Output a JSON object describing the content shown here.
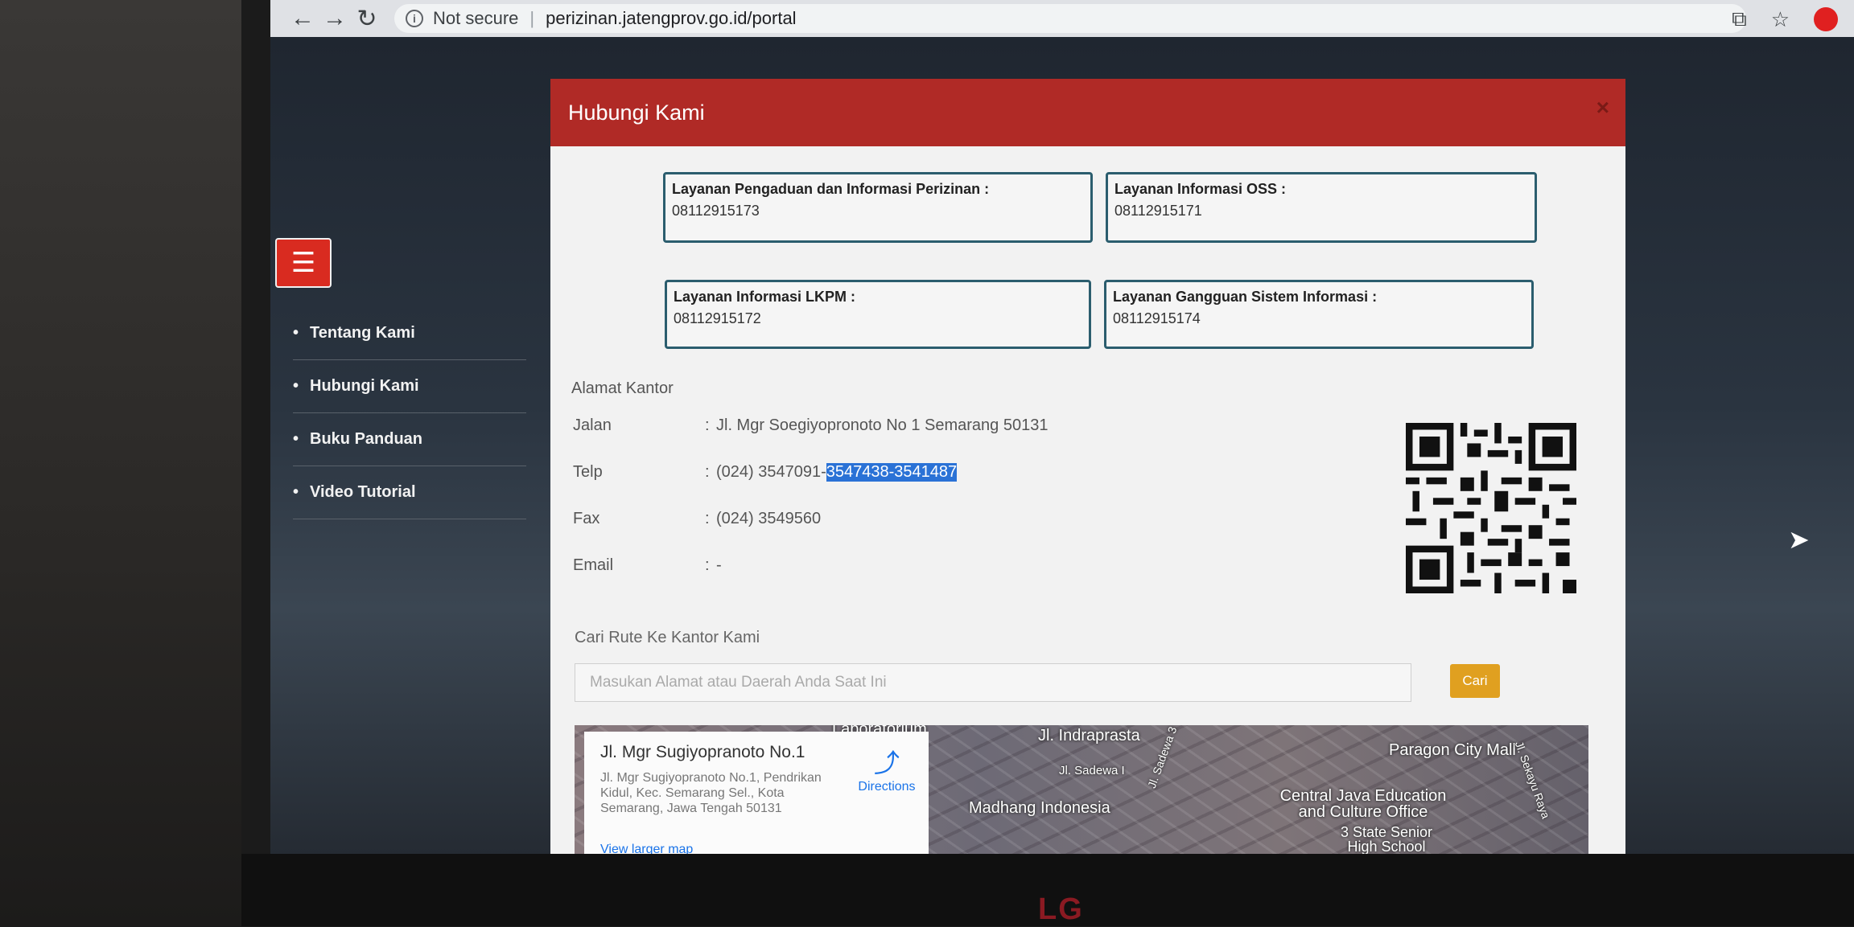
{
  "browser": {
    "security_label": "Not secure",
    "url": "perizinan.jatengprov.go.id/portal"
  },
  "sidebar": {
    "items": [
      {
        "label": "Tentang Kami"
      },
      {
        "label": "Hubungi Kami"
      },
      {
        "label": "Buku Panduan"
      },
      {
        "label": "Video Tutorial"
      }
    ]
  },
  "modal": {
    "title": "Hubungi Kami",
    "close": "×",
    "cards": [
      {
        "title": "Layanan Pengaduan dan Informasi Perizinan :",
        "phone": "08112915173"
      },
      {
        "title": "Layanan Informasi OSS :",
        "phone": "08112915171"
      },
      {
        "title": "Layanan Informasi LKPM :",
        "phone": "08112915172"
      },
      {
        "title": "Layanan Gangguan Sistem Informasi :",
        "phone": "08112915174"
      }
    ],
    "address_heading": "Alamat Kantor",
    "address": {
      "jalan_label": "Jalan",
      "jalan_value": "Jl. Mgr Soegiyopronoto No 1 Semarang 50131",
      "telp_label": "Telp",
      "telp_value_plain": "(024) 3547091-",
      "telp_value_selected": "3547438-3541487",
      "fax_label": "Fax",
      "fax_value": "(024) 3549560",
      "email_label": "Email",
      "email_value": "-",
      "colon": ":"
    },
    "route": {
      "label": "Cari Rute Ke Kantor Kami",
      "placeholder": "Masukan Alamat atau Daerah Anda Saat Ini",
      "button": "Cari"
    },
    "map": {
      "place_title": "Jl. Mgr Sugiyopranoto No.1",
      "place_address": "Jl. Mgr Sugiyopranoto No.1, Pendrikan Kidul, Kec. Semarang Sel., Kota Semarang, Jawa Tengah 50131",
      "directions": "Directions",
      "larger_map": "View larger map",
      "labels": [
        "Laboratorium",
        "Jl. Indraprasta",
        "Jl. Sadewa I",
        "Jl. Sadewa 3",
        "Madhang Indonesia",
        "Paragon City Mall",
        "Central Java Education and Culture Office",
        "3 State Senior High School",
        "Jl. Sekayu Raya"
      ]
    }
  },
  "monitor": {
    "brand": "LG"
  }
}
